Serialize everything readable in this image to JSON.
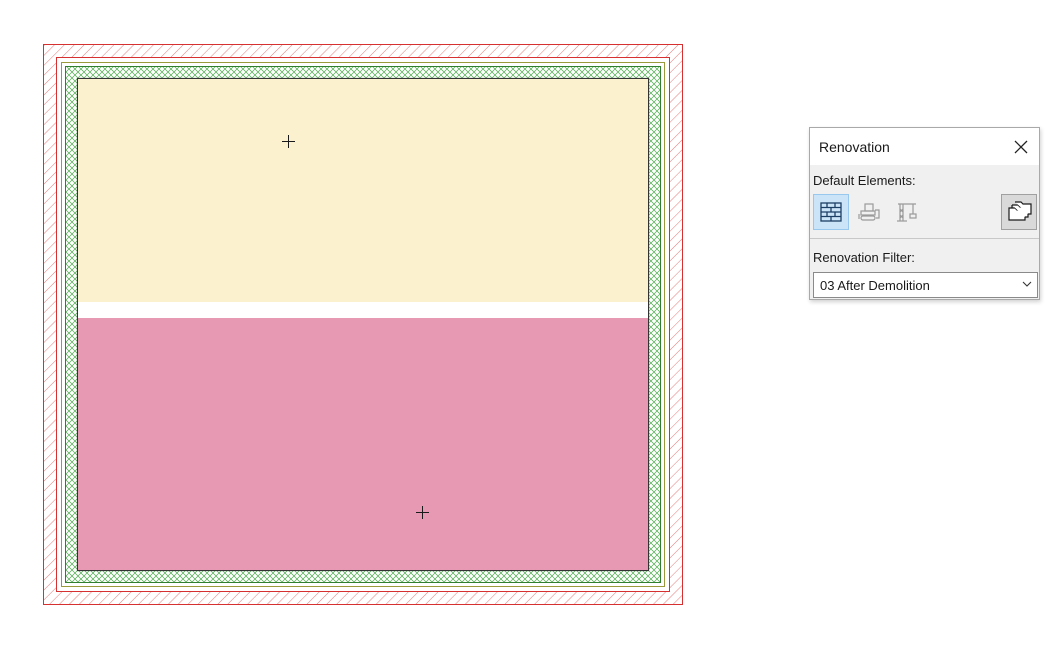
{
  "palette": {
    "title": "Renovation",
    "default_elements_label": "Default Elements:",
    "renovation_filter_label": "Renovation Filter:",
    "filter_selected": "03 After Demolition",
    "active_status": "existing",
    "buttons": {
      "existing": "brick-wall-icon",
      "demolish": "bulldozer-icon",
      "new": "crane-icon",
      "settings": "renovation-settings-icon",
      "close": "close-icon"
    }
  },
  "plan": {
    "zones": [
      {
        "name": "upper-zone",
        "fill": "#fcf1cf"
      },
      {
        "name": "lower-zone",
        "fill": "#e799b4"
      }
    ],
    "colors": {
      "outer_wall_hatch": "#e03a3a",
      "inner_wall_hatch": "#3c9a3c",
      "interior_line": "#333333",
      "olive_line": "#9a9a3a"
    }
  }
}
